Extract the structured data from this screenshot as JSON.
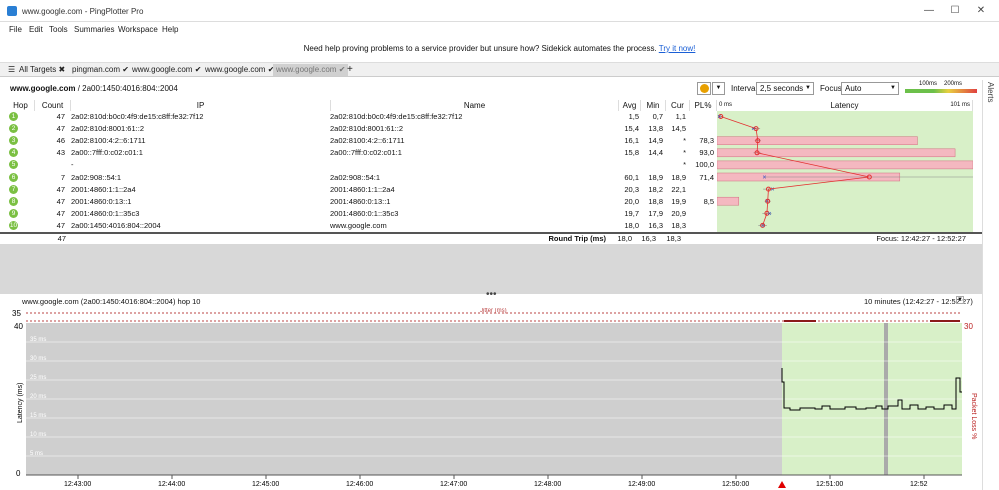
{
  "window": {
    "title": "www.google.com - PingPlotter Pro"
  },
  "menu": [
    "File",
    "Edit",
    "Tools",
    "Summaries",
    "Workspace",
    "Help"
  ],
  "notice": {
    "text": "Need help proving problems to a service provider but unsure how? Sidekick automates the process.",
    "link": "Try it now!"
  },
  "tabs": [
    {
      "label": "All Targets",
      "mark": "✖"
    },
    {
      "label": "pingman.com",
      "mark": "✔"
    },
    {
      "label": "www.google.com",
      "mark": "✔"
    },
    {
      "label": "www.google.com",
      "mark": "✔"
    },
    {
      "label": "www.google.com",
      "mark": "✔"
    }
  ],
  "target": {
    "host": "www.google.com",
    "address": " / 2a00:1450:4016:804::2004"
  },
  "controls": {
    "interval_label": "Interval",
    "interval_value": "2,5 seconds",
    "focus_label": "Focus",
    "focus_value": "Auto",
    "legend_100": "100ms",
    "legend_200": "200ms",
    "alerts": "Alerts"
  },
  "columns": {
    "hop": "Hop",
    "count": "Count",
    "ip": "IP",
    "name": "Name",
    "avg": "Avg",
    "min": "Min",
    "cur": "Cur",
    "pl": "PL%",
    "latency": "Latency",
    "lat_min": "0 ms",
    "lat_max": "101 ms"
  },
  "hops": [
    {
      "hop": "1",
      "count": "47",
      "ip": "2a02:810d:b0c0:4f9:de15:c8ff:fe32:7f12",
      "name": "2a02:810d:b0c0:4f9:de15:c8ff:fe32:7f12",
      "avg": "1,5",
      "min": "0,7",
      "cur": "1,1",
      "pl": ""
    },
    {
      "hop": "2",
      "count": "47",
      "ip": "2a02:810d:8001:61::2",
      "name": "2a02:810d:8001:61::2",
      "avg": "15,4",
      "min": "13,8",
      "cur": "14,5",
      "pl": ""
    },
    {
      "hop": "3",
      "count": "46",
      "ip": "2a02:8100:4:2::6:1711",
      "name": "2a02:8100:4:2::6:1711",
      "avg": "16,1",
      "min": "14,9",
      "cur": "*",
      "pl": "78,3"
    },
    {
      "hop": "4",
      "count": "43",
      "ip": "2a00::7fff:0:c02:c01:1",
      "name": "2a00::7fff:0:c02:c01:1",
      "avg": "15,8",
      "min": "14,4",
      "cur": "*",
      "pl": "93,0"
    },
    {
      "hop": "5",
      "count": "",
      "ip": "-",
      "name": "",
      "avg": "",
      "min": "",
      "cur": "*",
      "pl": "100,0"
    },
    {
      "hop": "6",
      "count": "7",
      "ip": "2a02:908::54:1",
      "name": "2a02:908::54:1",
      "avg": "60,1",
      "min": "18,9",
      "cur": "18,9",
      "pl": "71,4"
    },
    {
      "hop": "7",
      "count": "47",
      "ip": "2001:4860:1:1::2a4",
      "name": "2001:4860:1:1::2a4",
      "avg": "20,3",
      "min": "18,2",
      "cur": "22,1",
      "pl": ""
    },
    {
      "hop": "8",
      "count": "47",
      "ip": "2001:4860:0:13::1",
      "name": "2001:4860:0:13::1",
      "avg": "20,0",
      "min": "18,8",
      "cur": "19,9",
      "pl": "8,5"
    },
    {
      "hop": "9",
      "count": "47",
      "ip": "2001:4860:0:1::35c3",
      "name": "2001:4860:0:1::35c3",
      "avg": "19,7",
      "min": "17,9",
      "cur": "20,9",
      "pl": ""
    },
    {
      "hop": "10",
      "count": "47",
      "ip": "2a00:1450:4016:804::2004",
      "name": "www.google.com",
      "avg": "18,0",
      "min": "16,3",
      "cur": "18,3",
      "pl": ""
    }
  ],
  "roundtrip": {
    "count": "47",
    "label": "Round Trip (ms)",
    "avg": "18,0",
    "min": "16,3",
    "cur": "18,3",
    "focus": "Focus: 12:42:27 - 12:52:27"
  },
  "timegraph": {
    "title": "www.google.com (2a00:1450:4016:804::2004) hop 10",
    "range": "10 minutes (12:42:27 - 12:52:27)",
    "jitter_label": "Jitter (ms)",
    "jitter_max": "35",
    "ylabel": "Latency (ms)",
    "y2label": "Packet Loss %",
    "ymax": "40",
    "ymin": "0",
    "y2max": "30",
    "grid_labels": [
      "35 ms",
      "30 ms",
      "25 ms",
      "20 ms",
      "15 ms",
      "10 ms",
      "5 ms"
    ],
    "xticks": [
      "12:43:00",
      "12:44:00",
      "12:45:00",
      "12:46:00",
      "12:47:00",
      "12:48:00",
      "12:49:00",
      "12:50:00",
      "12:51:00",
      "12:52"
    ]
  },
  "colors": {
    "good": "#d8f0c8",
    "loss": "#f4b8c0",
    "accent": "#e8a000",
    "line": "#e33030",
    "marker": "#3050c0",
    "unreached": "#c8c8c8"
  }
}
